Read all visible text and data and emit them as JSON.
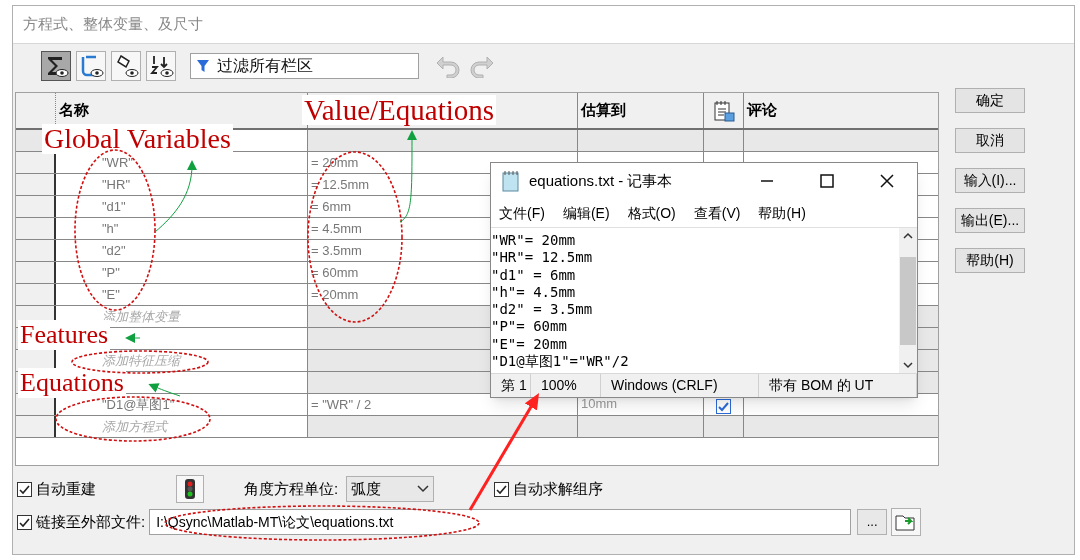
{
  "dialog": {
    "title": "方程式、整体变量、及尺寸"
  },
  "toolbar": {
    "view_toggles": [
      {
        "pressed": true
      },
      {
        "pressed": false
      },
      {
        "pressed": false
      },
      {
        "pressed": false
      }
    ],
    "filter": {
      "placeholder": "过滤所有栏区"
    }
  },
  "table": {
    "name_header": "名称",
    "evaluates_header": "估算到",
    "comment_header": "评论",
    "rows": [
      {
        "kind": "section"
      },
      {
        "kind": "item",
        "name": "\"WR\"",
        "value": "= 20mm"
      },
      {
        "kind": "item",
        "name": "\"HR\"",
        "value": "= 12.5mm"
      },
      {
        "kind": "item",
        "name": "\"d1\"",
        "value": "= 6mm"
      },
      {
        "kind": "item",
        "name": "\"h\"",
        "value": "= 4.5mm"
      },
      {
        "kind": "item",
        "name": "\"d2\"",
        "value": "= 3.5mm"
      },
      {
        "kind": "item",
        "name": "\"P\"",
        "value": "= 60mm"
      },
      {
        "kind": "item",
        "name": "\"E\"",
        "value": "= 20mm"
      },
      {
        "kind": "add",
        "name": "添加整体变量"
      },
      {
        "kind": "section"
      },
      {
        "kind": "add",
        "name": "添加特征压缩"
      },
      {
        "kind": "section"
      },
      {
        "kind": "item",
        "name": "\"D1@草图1\"",
        "value": "= \"WR\" / 2",
        "evaluates": "10mm",
        "checked": true
      },
      {
        "kind": "add",
        "name": "添加方程式"
      }
    ]
  },
  "buttons": [
    "确定",
    "取消",
    "输入(I)...",
    "输出(E)...",
    "帮助(H)"
  ],
  "options": {
    "auto_rebuild": {
      "label": "自动重建",
      "checked": true
    },
    "angle_unit": {
      "label": "角度方程单位:",
      "value": "弧度"
    },
    "auto_solve": {
      "label": "自动求解组序",
      "checked": true
    },
    "link_external": {
      "label": "链接至外部文件:",
      "checked": true,
      "path": "I:\\Qsync\\Matlab-MT\\论文\\equations.txt",
      "browse": "..."
    }
  },
  "notepad": {
    "title": "equations.txt - 记事本",
    "menu": [
      "文件(F)",
      "编辑(E)",
      "格式(O)",
      "查看(V)",
      "帮助(H)"
    ],
    "lines": [
      "\"WR\"= 20mm",
      "\"HR\"= 12.5mm",
      "\"d1\" = 6mm",
      "\"h\"= 4.5mm",
      "\"d2\" = 3.5mm",
      "\"P\"= 60mm",
      "\"E\"= 20mm",
      "\"D1@草图1\"=\"WR\"/2"
    ],
    "status": [
      "第 1",
      "100%",
      "Windows (CRLF)",
      "带有 BOM 的 UT"
    ]
  },
  "annotations": [
    {
      "text": "Value/Equations"
    },
    {
      "text": "Global Variables"
    },
    {
      "text": "Features"
    },
    {
      "text": "Equations"
    }
  ]
}
